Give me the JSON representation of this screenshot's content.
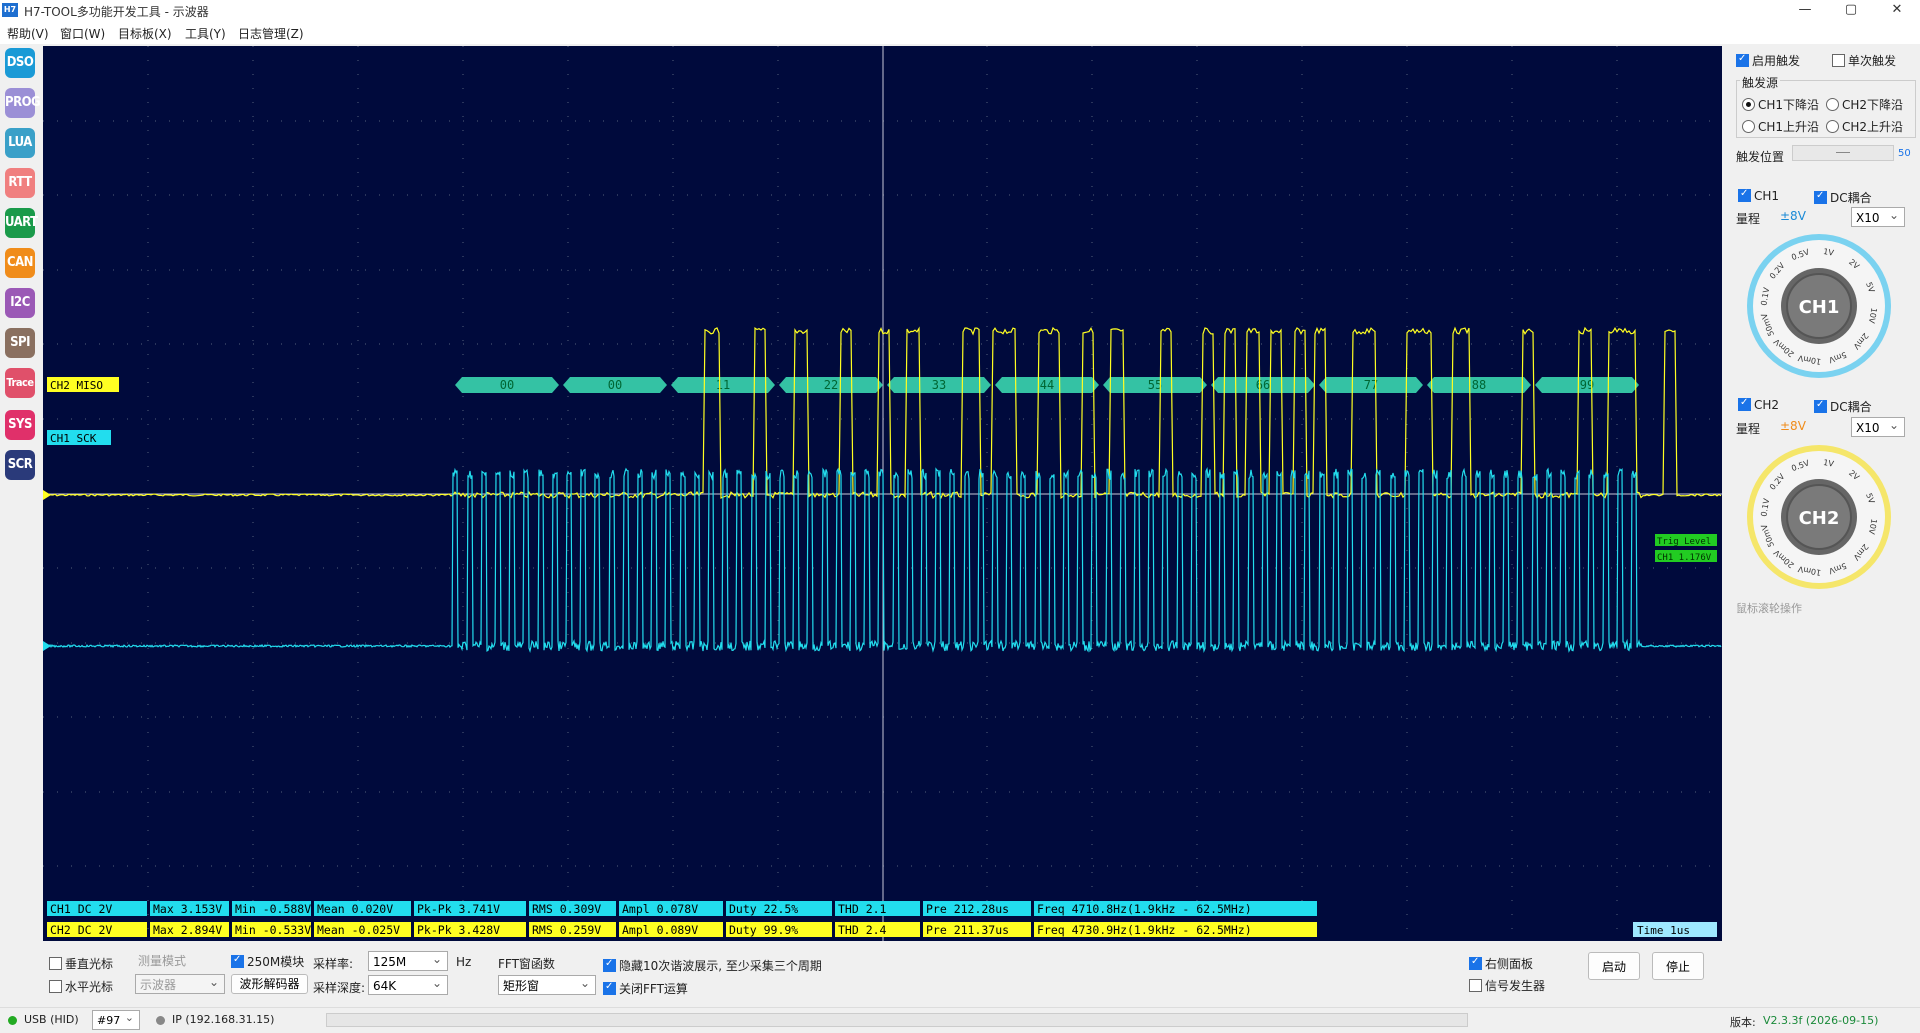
{
  "window": {
    "title": "H7-TOOL多功能开发工具 - 示波器",
    "logo": "H7",
    "min": "—",
    "max": "▢",
    "close": "✕"
  },
  "menu": [
    "帮助(V)",
    "窗口(W)",
    "目标板(X)",
    "工具(Y)",
    "日志管理(Z)"
  ],
  "sidebar": [
    {
      "label": "DSO",
      "color": "#1a9ad6"
    },
    {
      "label": "PROG",
      "color": "#9b8fd6"
    },
    {
      "label": "LUA",
      "color": "#3aa0c8"
    },
    {
      "label": "RTT",
      "color": "#f07f7f"
    },
    {
      "label": "UART",
      "color": "#1a9a4a"
    },
    {
      "label": "CAN",
      "color": "#f08c1a"
    },
    {
      "label": "I2C",
      "color": "#9b59b6"
    },
    {
      "label": "SPI",
      "color": "#8a7060"
    },
    {
      "label": "Trace",
      "color": "#e0506a"
    },
    {
      "label": "SYS",
      "color": "#e0306a"
    },
    {
      "label": "SCR",
      "color": "#2a3a7a"
    }
  ],
  "scope": {
    "ch2_label": "CH2 MISO",
    "ch1_label": "CH1 SCK",
    "bytes": [
      "00",
      "00",
      "11",
      "22",
      "33",
      "44",
      "55",
      "66",
      "77",
      "88",
      "99"
    ],
    "trig_label": "Trig Level",
    "trig_value": "CH1 1.176V",
    "time": "Time  1us",
    "ch1_color": "#ffff22",
    "ch2_color": "#22ddee",
    "ch1_meas": [
      {
        "key": "ch",
        "text": "CH1 DC   2V"
      },
      {
        "key": "max",
        "text": "Max  3.153V"
      },
      {
        "key": "min",
        "text": "Min -0.588V"
      },
      {
        "key": "mean",
        "text": "Mean  0.020V"
      },
      {
        "key": "pk",
        "text": "Pk-Pk  3.741V"
      },
      {
        "key": "rms",
        "text": "RMS  0.309V"
      },
      {
        "key": "ampl",
        "text": "Ampl  0.078V"
      },
      {
        "key": "duty",
        "text": "Duty  22.5%"
      },
      {
        "key": "thd",
        "text": "THD     2.1"
      },
      {
        "key": "pre",
        "text": "Pre  212.28us"
      },
      {
        "key": "freq",
        "text": "Freq     4710.8Hz(1.9kHz - 62.5MHz)"
      }
    ],
    "ch2_meas": [
      {
        "key": "ch",
        "text": "CH2 DC   2V"
      },
      {
        "key": "max",
        "text": "Max  2.894V"
      },
      {
        "key": "min",
        "text": "Min -0.533V"
      },
      {
        "key": "mean",
        "text": "Mean -0.025V"
      },
      {
        "key": "pk",
        "text": "Pk-Pk  3.428V"
      },
      {
        "key": "rms",
        "text": "RMS  0.259V"
      },
      {
        "key": "ampl",
        "text": "Ampl  0.089V"
      },
      {
        "key": "duty",
        "text": "Duty  99.9%"
      },
      {
        "key": "thd",
        "text": "THD     2.4"
      },
      {
        "key": "pre",
        "text": "Pre  211.37us"
      },
      {
        "key": "freq",
        "text": "Freq     4730.9Hz(1.9kHz - 62.5MHz)"
      }
    ]
  },
  "bottom": {
    "vcursor": "垂直光标",
    "hcursor": "水平光标",
    "measure_mode": "测量模式",
    "measure_value": "示波器",
    "module250": "250M模块",
    "decoder": "波形解码器",
    "rate_label": "采样率:",
    "rate_value": "125M",
    "hz": "Hz",
    "depth_label": "采样深度:",
    "depth_value": "64K",
    "fft_label": "FFT窗函数",
    "fft_value": "矩形窗",
    "hide_noise": "隐藏10次谐波展示, 至少采集三个周期",
    "close_fft": "关闭FFT运算",
    "right_panel": "右侧面板",
    "sig_gen": "信号发生器",
    "start": "启动",
    "stop": "停止"
  },
  "right": {
    "enable_trigger": "启用触发",
    "single_trigger": "单次触发",
    "trig_source": "触发源",
    "src_options": [
      "CH1下降沿",
      "CH2下降沿",
      "CH1上升沿",
      "CH2上升沿"
    ],
    "trig_pos": "触发位置",
    "trig_pos_value": "50",
    "ch1": "CH1",
    "ch1_dc": "DC耦合",
    "range": "量程",
    "ch1_range": "±8V",
    "ch1_probe": "X10",
    "ch2": "CH2",
    "ch2_dc": "DC耦合",
    "ch2_range": "±8V",
    "ch2_probe": "X10",
    "wheel_hint": "鼠标滚轮操作",
    "knob_labels": [
      "0.1V",
      "0.2V",
      "0.5V",
      "1V",
      "2V",
      "5V",
      "10V",
      "2mV",
      "5mV",
      "10mV",
      "20mV",
      "50mV"
    ]
  },
  "status": {
    "usb": "USB (HID)",
    "port": "#97",
    "ip": "IP (192.168.31.15)",
    "version_label": "版本:",
    "version": "V2.3.3f (2026-09-15)"
  }
}
